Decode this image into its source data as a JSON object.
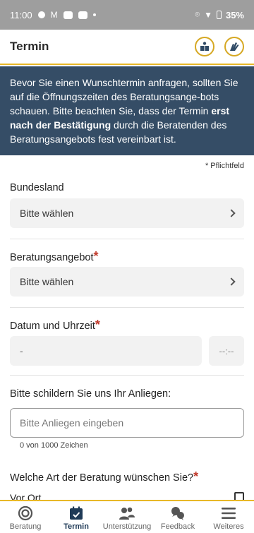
{
  "status_bar": {
    "time": "11:00",
    "battery": "35%"
  },
  "header": {
    "title": "Termin"
  },
  "banner": {
    "text_before": "Bevor Sie einen Wunschtermin anfragen, sollten Sie auf die Öffnungszeiten des Beratungsange-bots schauen. Bitte beachten Sie, dass der Termin ",
    "text_bold": "erst nach der Bestätigung",
    "text_after": " durch die Beratenden des Beratungsangebots fest vereinbart ist."
  },
  "form": {
    "required_note": "* Pflichtfeld",
    "state": {
      "label": "Bundesland",
      "value": "Bitte wählen"
    },
    "offer": {
      "label": "Beratungsangebot",
      "required_mark": "*",
      "value": "Bitte wählen"
    },
    "datetime": {
      "label": "Datum und Uhrzeit",
      "required_mark": "*",
      "date_value": "-",
      "time_value": "--:--"
    },
    "concern": {
      "label": "Bitte schildern Sie uns Ihr Anliegen:",
      "placeholder": "Bitte Anliegen eingeben",
      "counter": "0 von 1000 Zeichen"
    },
    "consult_type": {
      "label": "Welche Art der Beratung wünschen Sie?",
      "required_mark": "*",
      "option1": "Vor Ort"
    }
  },
  "bottom_nav": {
    "items": [
      {
        "label": "Beratung",
        "icon": "target-icon"
      },
      {
        "label": "Termin",
        "icon": "calendar-icon"
      },
      {
        "label": "Unterstützung",
        "icon": "people-icon"
      },
      {
        "label": "Feedback",
        "icon": "chat-icon"
      },
      {
        "label": "Weiteres",
        "icon": "menu-icon"
      }
    ],
    "active_index": 1
  },
  "colors": {
    "accent": "#e8b828",
    "banner": "#354d66",
    "required": "#c0392b",
    "active_nav": "#1f3a57"
  }
}
